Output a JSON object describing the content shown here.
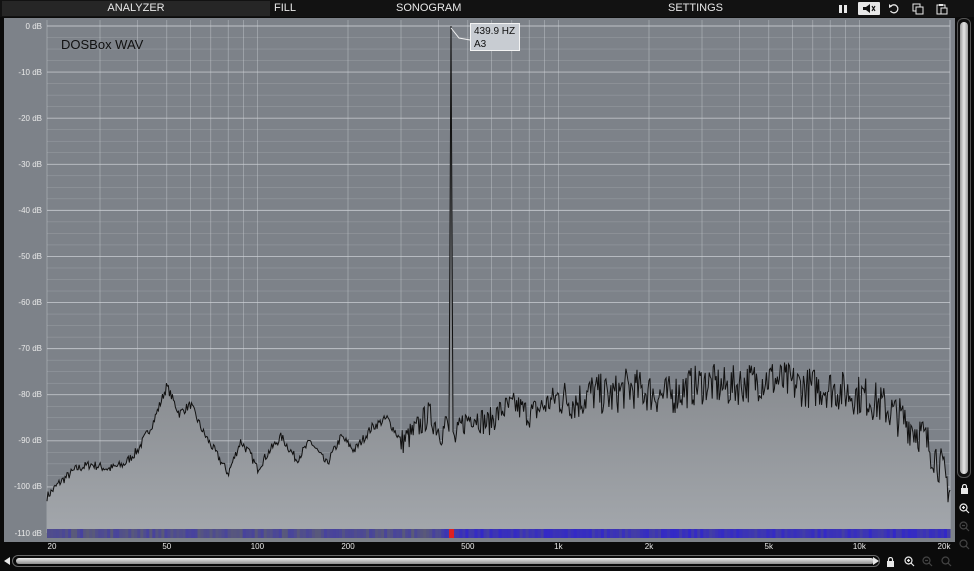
{
  "menu": {
    "tabs": [
      {
        "label": "ANALYZER",
        "active": true
      },
      {
        "label": "FILL",
        "active": false
      },
      {
        "label": "SONOGRAM",
        "active": false
      },
      {
        "label": "SETTINGS",
        "active": false
      }
    ],
    "buttons": [
      "pause-icon",
      "monitor-icon",
      "reset-icon",
      "copy-icon",
      "paste-icon"
    ]
  },
  "analyzer": {
    "source_label": "DOSBox WAV",
    "peak": {
      "freq_label": "439.9 HZ",
      "note_label": "A3",
      "freq": 439.9,
      "db": 0
    },
    "y_tick_labels": [
      "0 dB",
      "-10 dB",
      "-20 dB",
      "-30 dB",
      "-40 dB",
      "-50 dB",
      "-60 dB",
      "-70 dB",
      "-80 dB",
      "-90 dB",
      "-100 dB",
      "-110 dB"
    ],
    "x_tick_labels": [
      "20",
      "50",
      "100",
      "200",
      "500",
      "1k",
      "2k",
      "5k",
      "10k",
      "20k"
    ],
    "colors": {
      "background": "#7d8289",
      "grid": "#cfd3d8",
      "fill_dark": "#4b4d50",
      "fill_light": "#a3a7ac",
      "curve": "#111111",
      "peak_band": "#e02020",
      "band_blue": "#3030b0"
    }
  },
  "chart_data": {
    "type": "area",
    "xscale": "log",
    "xlim": [
      20,
      20000
    ],
    "ylim": [
      -110,
      0
    ],
    "xlabel": "",
    "ylabel": "",
    "x": [
      20,
      22,
      25,
      28,
      32,
      36,
      40,
      45,
      50,
      55,
      60,
      66,
      72,
      80,
      88,
      95,
      100,
      110,
      120,
      135,
      150,
      170,
      190,
      210,
      240,
      270,
      300,
      330,
      370,
      410,
      430,
      440,
      450,
      480,
      520,
      580,
      650,
      720,
      800,
      900,
      1000,
      1150,
      1300,
      1500,
      1700,
      2000,
      2300,
      2700,
      3100,
      3600,
      4200,
      5000,
      5800,
      6700,
      7800,
      9000,
      10500,
      12000,
      14000,
      16000,
      18000,
      20000
    ],
    "values": [
      -102,
      -99,
      -96,
      -95,
      -96,
      -95,
      -92,
      -86,
      -78,
      -84,
      -82,
      -88,
      -92,
      -97,
      -90,
      -93,
      -96,
      -92,
      -89,
      -94,
      -90,
      -95,
      -89,
      -92,
      -87,
      -85,
      -90,
      -88,
      -84,
      -88,
      -85,
      0,
      -90,
      -86,
      -84,
      -86,
      -83,
      -82,
      -84,
      -82,
      -80,
      -81,
      -79,
      -80,
      -78,
      -79,
      -80,
      -78,
      -77,
      -78,
      -77,
      -76,
      -77,
      -78,
      -78,
      -79,
      -80,
      -82,
      -85,
      -88,
      -93,
      -100
    ]
  },
  "bottom": {
    "icons": [
      "lock-icon",
      "zoom-in-icon",
      "zoom-out-icon",
      "zoom-reset-icon"
    ]
  },
  "side": {
    "icons": [
      "lock-icon",
      "zoom-in-icon",
      "zoom-out-icon",
      "zoom-reset-icon"
    ]
  }
}
